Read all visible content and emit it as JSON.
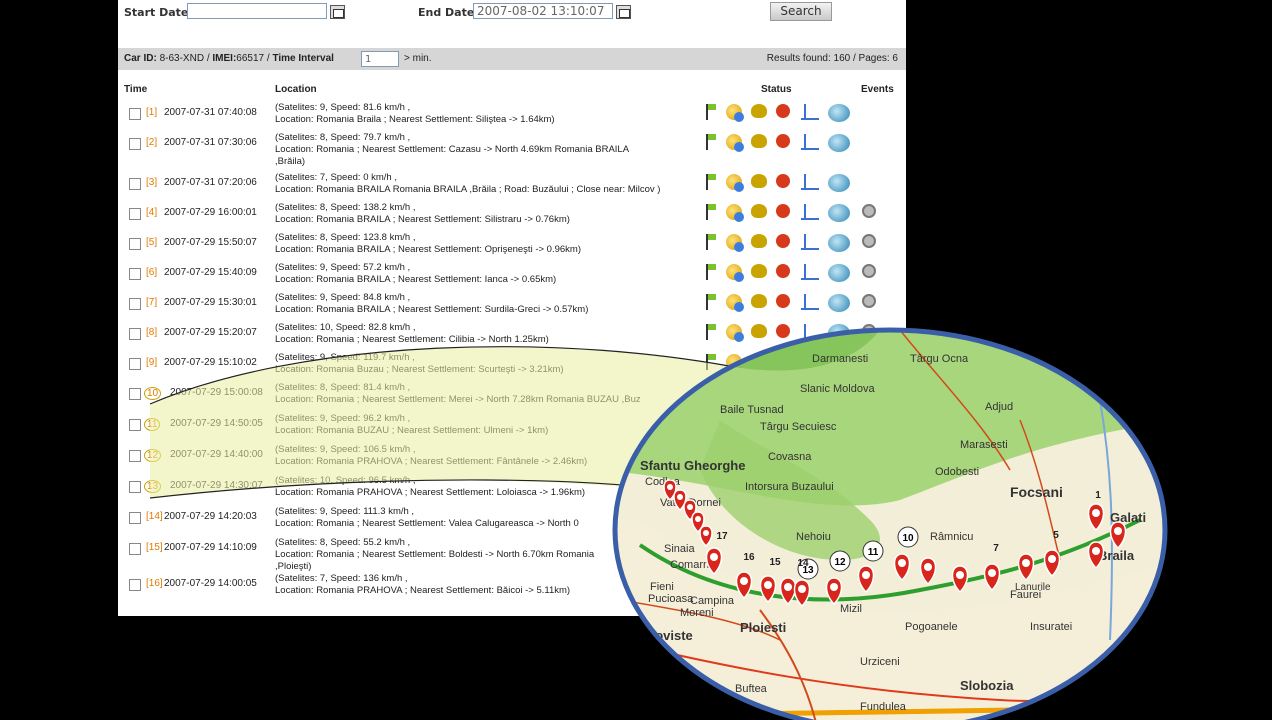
{
  "search": {
    "start_label": "Start Date:",
    "start_value": "",
    "end_label": "End Date:",
    "end_value": "2007-08-02 13:10:07",
    "button": "Search"
  },
  "info": {
    "car_label": "Car ID:",
    "car_id": "8-63-XND",
    "imei_label": "IMEI:",
    "imei": "66517",
    "interval_label": "Time Interval",
    "interval_value": "1",
    "unit": "min.",
    "results": "Results found: 160 / Pages: 6"
  },
  "columns": {
    "time": "Time",
    "location": "Location",
    "status": "Status",
    "events": "Events"
  },
  "icons": [
    "flag-icon",
    "satellite-icon",
    "dial-icon",
    "light-icon",
    "antenna-icon",
    "globe-icon",
    "gear-icon"
  ],
  "colors": {
    "highlight": "#e8f0a8",
    "marker": "#d9261c",
    "route": "#2e9e2e",
    "index": "#e07b00"
  },
  "rows": [
    {
      "index": "[1]",
      "time": "2007-07-31 07:40:08",
      "line1": "(Satelites: 9, Speed: 81.6 km/h ,",
      "line2": "Location: Romania Braila ; Nearest Settlement: Siliştea -> 1.64km)",
      "line3": ""
    },
    {
      "index": "[2]",
      "time": "2007-07-31 07:30:06",
      "line1": "(Satelites: 8, Speed: 79.7 km/h ,",
      "line2": "Location: Romania ; Nearest Settlement: Cazasu -> North 4.69km Romania BRAILA",
      "line3": ",Brăila)"
    },
    {
      "index": "[3]",
      "time": "2007-07-31 07:20:06",
      "line1": "(Satelites: 7, Speed: 0 km/h ,",
      "line2": "Location: Romania BRAILA Romania BRAILA ,Brăila ; Road: Buzăului ; Close near: Milcov )",
      "line3": ""
    },
    {
      "index": "[4]",
      "time": "2007-07-29 16:00:01",
      "line1": "(Satelites: 8, Speed: 138.2 km/h ,",
      "line2": "Location: Romania BRAILA ; Nearest Settlement: Silistraru -> 0.76km)",
      "line3": ""
    },
    {
      "index": "[5]",
      "time": "2007-07-29 15:50:07",
      "line1": "(Satelites: 8, Speed: 123.8 km/h ,",
      "line2": "Location: Romania BRAILA ; Nearest Settlement: Oprişeneşti -> 0.96km)",
      "line3": ""
    },
    {
      "index": "[6]",
      "time": "2007-07-29 15:40:09",
      "line1": "(Satelites: 9, Speed: 57.2 km/h ,",
      "line2": "Location: Romania BRAILA ; Nearest Settlement: Ianca -> 0.65km)",
      "line3": ""
    },
    {
      "index": "[7]",
      "time": "2007-07-29 15:30:01",
      "line1": "(Satelites: 9, Speed: 84.8 km/h ,",
      "line2": "Location: Romania BRAILA ; Nearest Settlement: Surdila-Greci -> 0.57km)",
      "line3": ""
    },
    {
      "index": "[8]",
      "time": "2007-07-29 15:20:07",
      "line1": "(Satelites: 10, Speed: 82.8 km/h ,",
      "line2": "Location: Romania ; Nearest Settlement: Cilibia -> North 1.25km)",
      "line3": ""
    },
    {
      "index": "[9]",
      "time": "2007-07-29 15:10:02",
      "line1": "(Satelites: 9, Speed: 119.7 km/h ,",
      "line2": "Location: Romania Buzau ; Nearest Settlement: Scurteşti -> 3.21km)",
      "line3": ""
    },
    {
      "index": "10",
      "time": "2007-07-29 15:00:08",
      "line1": "(Satelites: 8, Speed: 81.4 km/h ,",
      "line2": "Location: Romania ; Nearest Settlement: Merei -> North 7.28km Romania BUZAU ,Buz",
      "line3": ""
    },
    {
      "index": "11",
      "time": "2007-07-29 14:50:05",
      "line1": "(Satelites: 9, Speed: 96.2 km/h ,",
      "line2": "Location: Romania BUZAU ; Nearest Settlement: Ulmeni -> 1km)",
      "line3": ""
    },
    {
      "index": "12",
      "time": "2007-07-29 14:40:00",
      "line1": "(Satelites: 9, Speed: 106.5 km/h ,",
      "line2": "Location: Romania PRAHOVA ; Nearest Settlement: Fântânele -> 2.46km)",
      "line3": ""
    },
    {
      "index": "13",
      "time": "2007-07-29 14:30:07",
      "line1": "(Satelites: 10, Speed: 96.5 km/h ,",
      "line2": "Location: Romania PRAHOVA ; Nearest Settlement: Loloiasca -> 1.96km)",
      "line3": ""
    },
    {
      "index": "[14]",
      "time": "2007-07-29 14:20:03",
      "line1": "(Satelites: 9, Speed: 111.3 km/h ,",
      "line2": "Location: Romania ; Nearest Settlement: Valea Calugareasca -> North 0",
      "line3": ""
    },
    {
      "index": "[15]",
      "time": "2007-07-29 14:10:09",
      "line1": "(Satelites: 8, Speed: 55.2 km/h ,",
      "line2": "Location: Romania ; Nearest Settlement: Boldesti -> North 6.70km Romania",
      "line3": ",Ploieşti)"
    },
    {
      "index": "[16]",
      "time": "2007-07-29 14:00:05",
      "line1": "(Satelites: 7, Speed: 136 km/h ,",
      "line2": "Location: Romania PRAHOVA ; Nearest Settlement: Băicoi -> 5.11km)",
      "line3": ""
    }
  ],
  "map": {
    "places": [
      "Darmanesti",
      "Târgu Ocna",
      "Slanic Moldova",
      "Adjud",
      "Baile Tusnad",
      "Marasesti",
      "Târgu Secuiesc",
      "Covasna",
      "Odobesti",
      "Focsani",
      "Intorsura Buzaului",
      "Nehoiu",
      "Râmnicu",
      "Galati",
      "Braila",
      "Sinaia",
      "Comarnic",
      "Fieni",
      "Pucioasa",
      "Moreni",
      "Campina",
      "Ploiesti",
      "Targoviste",
      "Pogoanele",
      "Insuratei",
      "Slobozia",
      "Urziceni",
      "Faurei",
      "Lanurile",
      "Mizil",
      "Buftea",
      "Fundulea",
      "Sfantu Gheorghe",
      "Codlea",
      "Vatra Dornei"
    ],
    "marker_labels": [
      "1",
      "5",
      "7",
      "10",
      "11",
      "12",
      "13",
      "14",
      "15",
      "16",
      "17"
    ]
  }
}
